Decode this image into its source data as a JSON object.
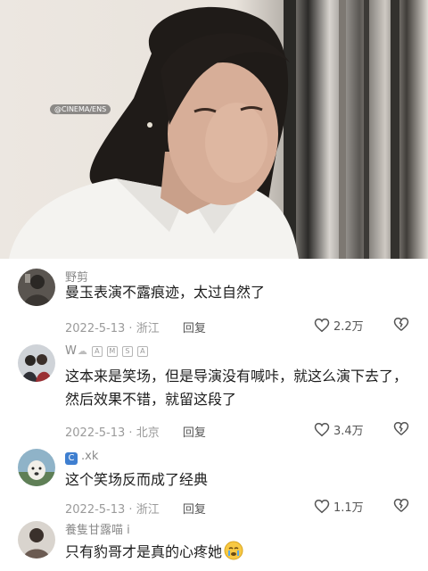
{
  "video": {
    "watermark": "@CINEMA/ENS"
  },
  "comments": [
    {
      "username": "野剪",
      "badges": [],
      "text": "曼玉表演不露痕迹，太过自然了",
      "date": "2022-5-13",
      "location": "浙江",
      "reply": "回复",
      "likes": "2.2万",
      "avatar": "photo-person-dark"
    },
    {
      "username": "W",
      "badges": [
        "A",
        "M",
        "S",
        "A"
      ],
      "text": "这本来是笑场，但是导演没有喊咔，就这么演下去了，然后效果不错，就留这段了",
      "date": "2022-5-13",
      "location": "北京",
      "reply": "回复",
      "likes": "3.4万",
      "avatar": "photo-couple"
    },
    {
      "username": ".xk",
      "badges": [],
      "text": "这个笑场反而成了经典",
      "date": "2022-5-13",
      "location": "浙江",
      "reply": "回复",
      "likes": "1.1万",
      "avatar": "photo-dog"
    },
    {
      "username": "養隻甘露喵 i",
      "badges": [],
      "text": "只有豹哥才是真的心疼她",
      "date": "",
      "location": "",
      "reply": "",
      "likes": "",
      "avatar": "photo-portrait"
    }
  ],
  "icons": {
    "like": "heart-outline-icon",
    "dislike": "broken-heart-icon",
    "emoji": "crying-face-emoji"
  },
  "colors": {
    "text": "#1d1d1d",
    "meta": "#9a9a9a",
    "username": "#8a8a8a"
  }
}
